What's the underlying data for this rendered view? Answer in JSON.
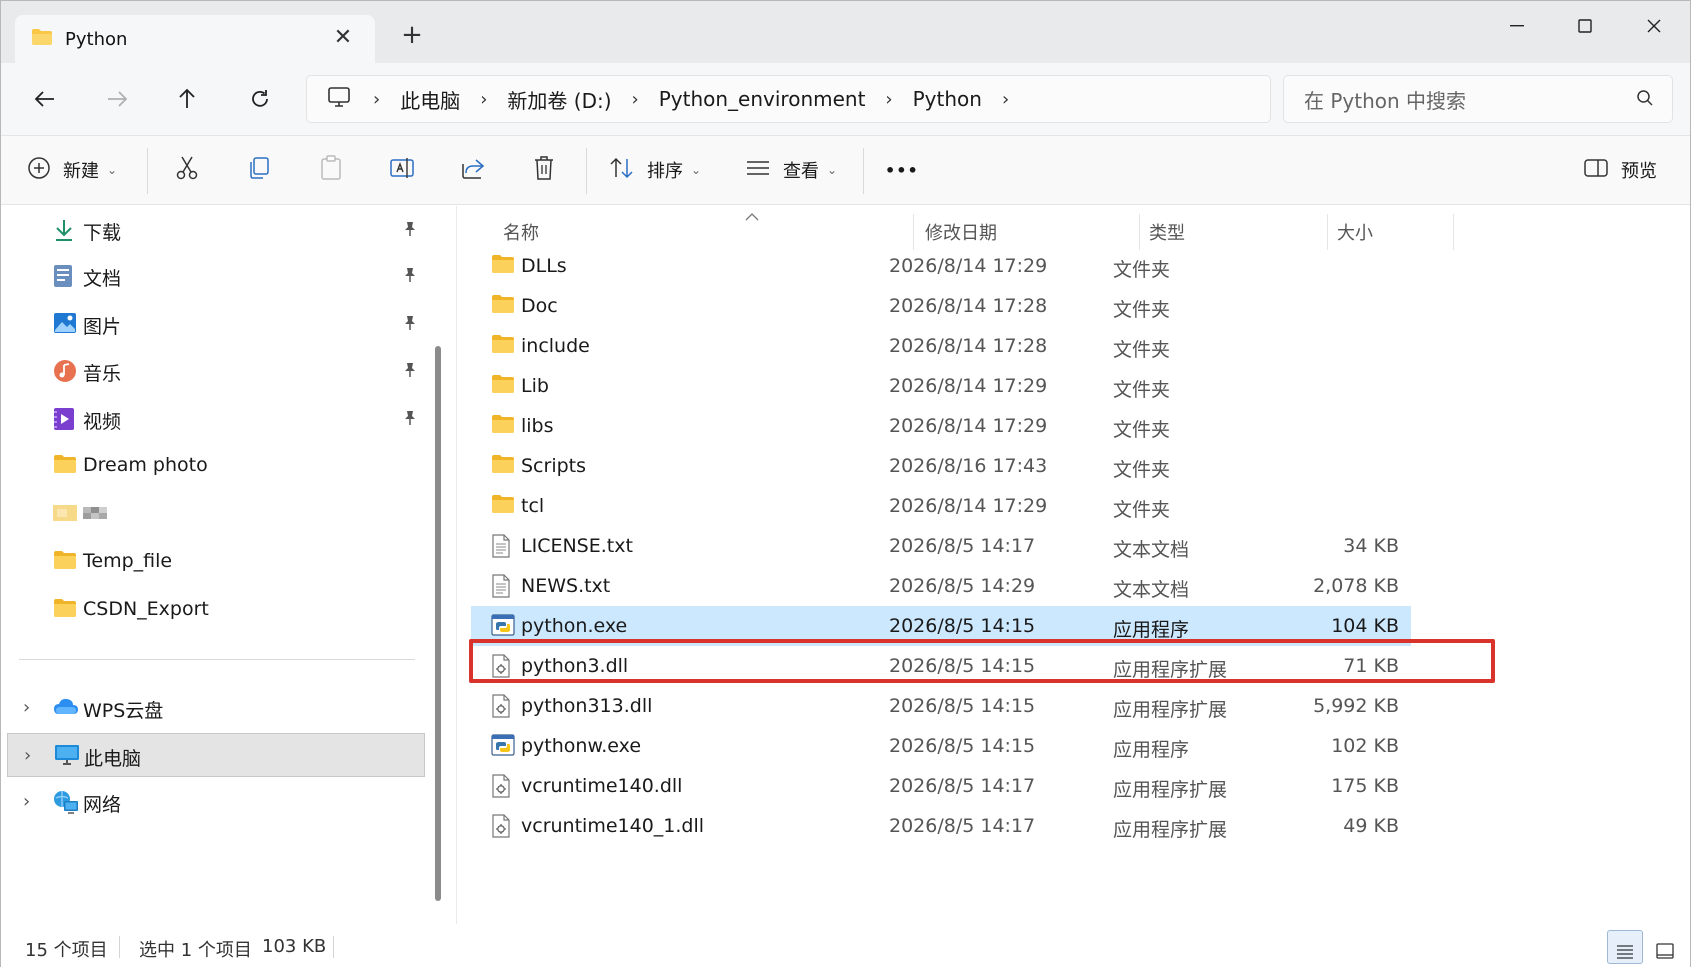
{
  "window": {
    "tab_title": "Python",
    "tab_close": "✕",
    "new_tab": "+",
    "minimize": "—",
    "maximize": "☐",
    "close": "✕"
  },
  "nav": {
    "breadcrumb": [
      "此电脑",
      "新加卷 (D:)",
      "Python_environment",
      "Python"
    ],
    "search_placeholder": "在 Python 中搜索"
  },
  "toolbar": {
    "new_label": "新建",
    "sort_label": "排序",
    "view_label": "查看",
    "more_label": "•••",
    "preview_label": "预览"
  },
  "sidebar": {
    "quick_access": [
      {
        "label": "下载",
        "icon": "download-icon",
        "pinned": true
      },
      {
        "label": "文档",
        "icon": "documents-icon",
        "pinned": true
      },
      {
        "label": "图片",
        "icon": "pictures-icon",
        "pinned": true
      },
      {
        "label": "音乐",
        "icon": "music-icon",
        "pinned": true
      },
      {
        "label": "视频",
        "icon": "videos-icon",
        "pinned": true
      },
      {
        "label": "Dream photo",
        "icon": "folder-icon",
        "pinned": false
      },
      {
        "label": "",
        "icon": "folder-icon",
        "pinned": false,
        "blurred": true
      },
      {
        "label": "Temp_file",
        "icon": "folder-icon",
        "pinned": false
      },
      {
        "label": "CSDN_Export",
        "icon": "folder-icon",
        "pinned": false
      }
    ],
    "locations": [
      {
        "label": "WPS云盘",
        "icon": "cloud-icon"
      },
      {
        "label": "此电脑",
        "icon": "computer-icon",
        "selected": true
      },
      {
        "label": "网络",
        "icon": "network-icon"
      }
    ]
  },
  "columns": {
    "name": "名称",
    "date": "修改日期",
    "type": "类型",
    "size": "大小"
  },
  "files": [
    {
      "name": "DLLs",
      "date": "2026/8/14 17:29",
      "type": "文件夹",
      "size": "",
      "icon": "folder-icon"
    },
    {
      "name": "Doc",
      "date": "2026/8/14 17:28",
      "type": "文件夹",
      "size": "",
      "icon": "folder-icon"
    },
    {
      "name": "include",
      "date": "2026/8/14 17:28",
      "type": "文件夹",
      "size": "",
      "icon": "folder-icon"
    },
    {
      "name": "Lib",
      "date": "2026/8/14 17:29",
      "type": "文件夹",
      "size": "",
      "icon": "folder-icon"
    },
    {
      "name": "libs",
      "date": "2026/8/14 17:29",
      "type": "文件夹",
      "size": "",
      "icon": "folder-icon"
    },
    {
      "name": "Scripts",
      "date": "2026/8/16 17:43",
      "type": "文件夹",
      "size": "",
      "icon": "folder-icon"
    },
    {
      "name": "tcl",
      "date": "2026/8/14 17:29",
      "type": "文件夹",
      "size": "",
      "icon": "folder-icon"
    },
    {
      "name": "LICENSE.txt",
      "date": "2026/8/5 14:17",
      "type": "文本文档",
      "size": "34 KB",
      "icon": "text-file-icon"
    },
    {
      "name": "NEWS.txt",
      "date": "2026/8/5 14:29",
      "type": "文本文档",
      "size": "2,078 KB",
      "icon": "text-file-icon"
    },
    {
      "name": "python.exe",
      "date": "2026/8/5 14:15",
      "type": "应用程序",
      "size": "104 KB",
      "icon": "python-exe-icon",
      "selected": true
    },
    {
      "name": "python3.dll",
      "date": "2026/8/5 14:15",
      "type": "应用程序扩展",
      "size": "71 KB",
      "icon": "dll-file-icon"
    },
    {
      "name": "python313.dll",
      "date": "2026/8/5 14:15",
      "type": "应用程序扩展",
      "size": "5,992 KB",
      "icon": "dll-file-icon"
    },
    {
      "name": "pythonw.exe",
      "date": "2026/8/5 14:15",
      "type": "应用程序",
      "size": "102 KB",
      "icon": "python-exe-icon"
    },
    {
      "name": "vcruntime140.dll",
      "date": "2026/8/5 14:17",
      "type": "应用程序扩展",
      "size": "175 KB",
      "icon": "dll-file-icon"
    },
    {
      "name": "vcruntime140_1.dll",
      "date": "2026/8/5 14:17",
      "type": "应用程序扩展",
      "size": "49 KB",
      "icon": "dll-file-icon"
    }
  ],
  "status": {
    "item_count": "15 个项目",
    "selection": "选中 1 个项目",
    "selection_size": "103 KB"
  },
  "colors": {
    "accent": "#0067c0",
    "selection_bg": "#cce8ff",
    "highlight_border": "#d9342b",
    "folder_yellow": "#f8c846"
  }
}
